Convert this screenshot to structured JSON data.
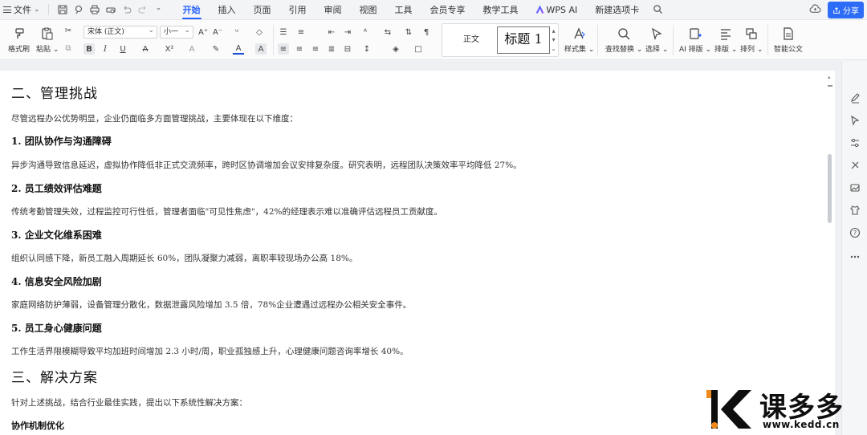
{
  "menubar": {
    "file_label": "文件",
    "tabs": [
      {
        "label": "开始",
        "active": true
      },
      {
        "label": "插入"
      },
      {
        "label": "页面"
      },
      {
        "label": "引用"
      },
      {
        "label": "审阅"
      },
      {
        "label": "视图"
      },
      {
        "label": "工具"
      },
      {
        "label": "会员专享"
      },
      {
        "label": "教学工具"
      },
      {
        "label": "WPS AI"
      },
      {
        "label": "新建选项卡"
      }
    ],
    "share_label": "分享"
  },
  "ribbon": {
    "format_painter": "格式刷",
    "paste": "粘贴",
    "font_name": "宋体 (正文)",
    "font_size": "小一",
    "style_normal": "正文",
    "style_heading1": "标题 1",
    "style_set": "样式集",
    "find_replace": "查找替换",
    "select": "选择",
    "ai_layout": "AI 排版",
    "layout": "排版",
    "arrange": "排列",
    "smart_doc": "智能公文",
    "accent_color": "#2662ff",
    "font_color": "#1f4fd8"
  },
  "document": {
    "section2_title": "二、管理挑战",
    "section2_intro": "尽管远程办公优势明显，企业仍面临多方面管理挑战，主要体现在以下维度：",
    "items": [
      {
        "title": "1.  团队协作与沟通障碍",
        "body": "异步沟通导致信息延迟，虚拟协作降低非正式交流频率，跨时区协调增加会议安排复杂度。研究表明，远程团队决策效率平均降低 27%。"
      },
      {
        "title": "2.  员工绩效评估难题",
        "body": "传统考勤管理失效，过程监控可行性低，管理者面临\"可见性焦虑\"，42%的经理表示难以准确评估远程员工贡献度。"
      },
      {
        "title": "3.  企业文化维系困难",
        "body": "组织认同感下降，新员工融入周期延长 60%，团队凝聚力减弱，离职率较现场办公高 18%。"
      },
      {
        "title": "4.  信息安全风险加剧",
        "body": "家庭网络防护薄弱，设备管理分散化，数据泄露风险增加 3.5 倍，78%企业遭遇过远程办公相关安全事件。"
      },
      {
        "title": "5.  员工身心健康问题",
        "body": "工作生活界限模糊导致平均加班时间增加 2.3 小时/周，职业孤独感上升，心理健康问题咨询率增长 40%。"
      }
    ],
    "section3_title": "三、解决方案",
    "section3_intro": "针对上述挑战，结合行业最佳实践，提出以下系统性解决方案：",
    "subsection_title": "协作机制优化"
  },
  "watermark": {
    "brand": "课多多",
    "url": "www.kedd.cn"
  }
}
